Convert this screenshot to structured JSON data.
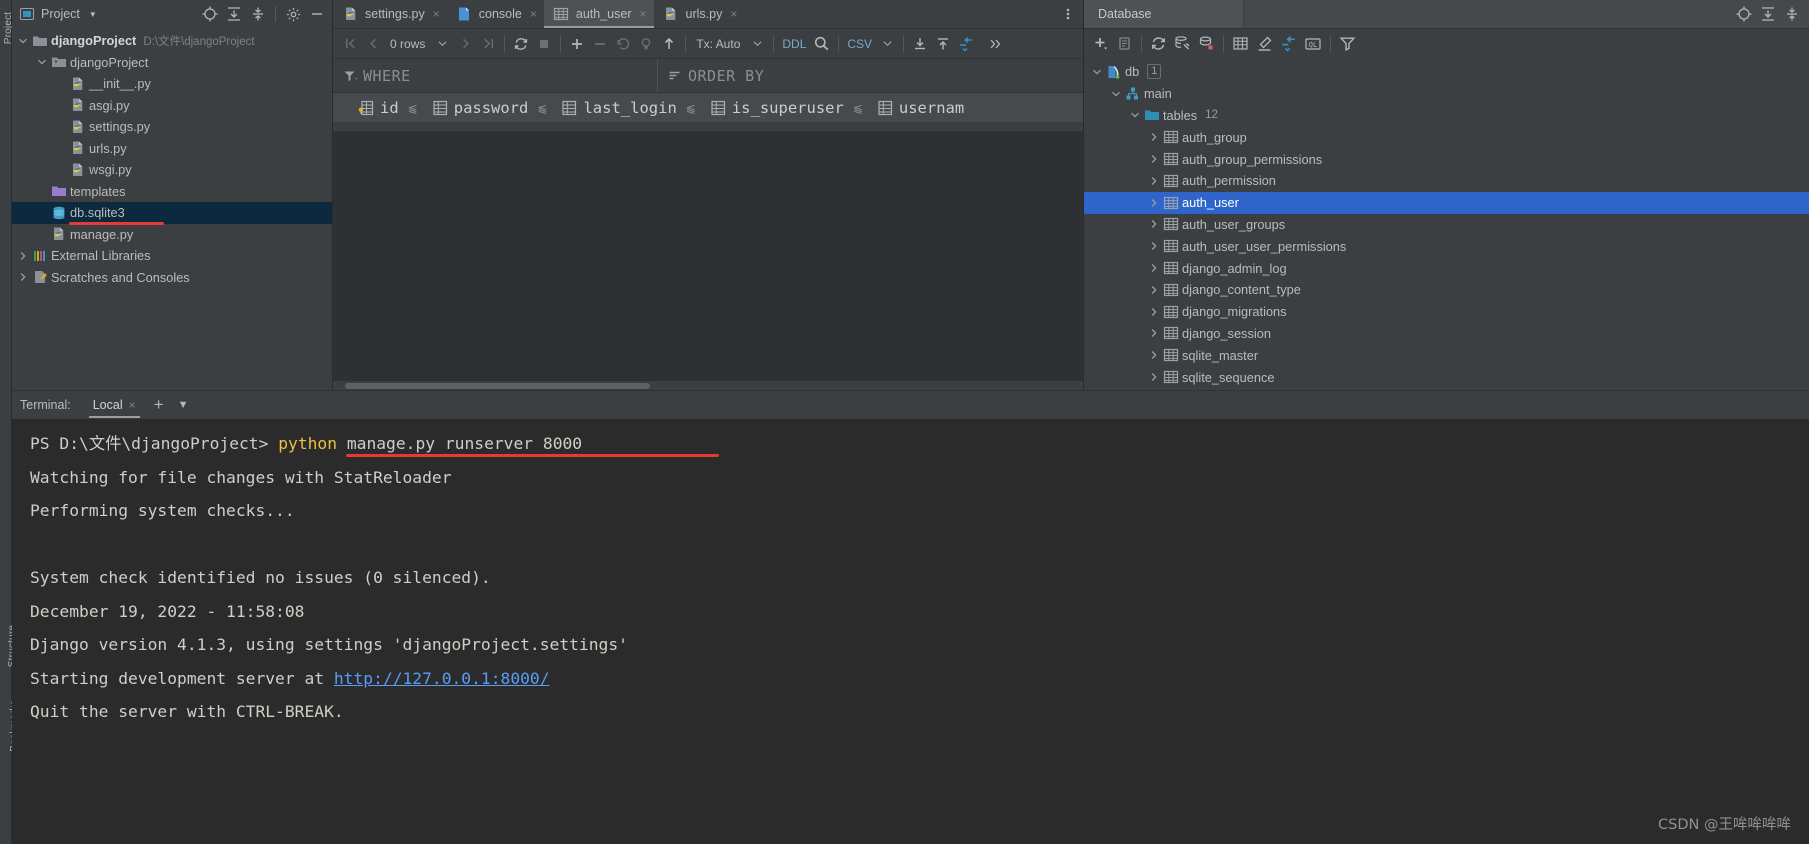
{
  "left_strip": {
    "project_tab": "Project",
    "structure_tab": "Structure",
    "bookmarks_tab": "Bookmarks"
  },
  "project_panel": {
    "title": "Project",
    "tools": [
      "locate-icon",
      "expand-all-icon",
      "collapse-all-icon",
      "settings-icon",
      "hide-icon"
    ],
    "tree": [
      {
        "label": "djangoProject",
        "path": "D:\\文件\\djangoProject",
        "icon": "folder-module-icon",
        "arrow": "expanded",
        "indent": 0,
        "bold": true
      },
      {
        "label": "djangoProject",
        "path": "",
        "icon": "folder-package-icon",
        "arrow": "expanded",
        "indent": 1,
        "bold": false
      },
      {
        "label": "__init__.py",
        "path": "",
        "icon": "python-file-icon",
        "arrow": "none",
        "indent": 2,
        "bold": false
      },
      {
        "label": "asgi.py",
        "path": "",
        "icon": "python-file-icon",
        "arrow": "none",
        "indent": 2,
        "bold": false
      },
      {
        "label": "settings.py",
        "path": "",
        "icon": "python-file-icon",
        "arrow": "none",
        "indent": 2,
        "bold": false
      },
      {
        "label": "urls.py",
        "path": "",
        "icon": "python-file-icon",
        "arrow": "none",
        "indent": 2,
        "bold": false
      },
      {
        "label": "wsgi.py",
        "path": "",
        "icon": "python-file-icon",
        "arrow": "none",
        "indent": 2,
        "bold": false
      },
      {
        "label": "templates",
        "path": "",
        "icon": "folder-templates-icon",
        "arrow": "none",
        "indent": 1,
        "bold": false
      },
      {
        "label": "db.sqlite3",
        "path": "",
        "icon": "database-file-icon",
        "arrow": "none",
        "indent": 1,
        "bold": false,
        "selected": true,
        "underlined": true
      },
      {
        "label": "manage.py",
        "path": "",
        "icon": "python-file-icon",
        "arrow": "none",
        "indent": 1,
        "bold": false
      },
      {
        "label": "External Libraries",
        "path": "",
        "icon": "libraries-icon",
        "arrow": "collapsed",
        "indent": 0,
        "bold": false
      },
      {
        "label": "Scratches and Consoles",
        "path": "",
        "icon": "scratches-icon",
        "arrow": "collapsed",
        "indent": 0,
        "bold": false
      }
    ]
  },
  "editor": {
    "tabs": [
      {
        "label": "settings.py",
        "icon": "python-file-icon",
        "active": false
      },
      {
        "label": "console",
        "icon": "console-icon",
        "active": false
      },
      {
        "label": "auth_user",
        "icon": "table-icon",
        "active": true
      },
      {
        "label": "urls.py",
        "icon": "python-file-icon",
        "active": false
      }
    ],
    "tab_close_glyph": "×",
    "overflow_icon": "more-options-icon",
    "grid_toolbar": {
      "first_page": "first-page-icon",
      "prev_page": "prev-page-icon",
      "rows_label": "0 rows",
      "next_page": "next-page-icon",
      "last_page": "last-page-icon",
      "reload": "reload-icon",
      "stop": "stop-icon",
      "add_row": "add-row-icon",
      "delete_row": "delete-row-icon",
      "revert": "revert-icon",
      "commit": "commit-icon",
      "submit": "submit-icon",
      "tx_label": "Tx: Auto",
      "ddl_label": "DDL",
      "search": "search-icon",
      "csv_label": "CSV",
      "import": "import-icon",
      "export": "export-icon",
      "compare": "compare-icon",
      "expand": "expand-toolbar-icon"
    },
    "filters": {
      "where_label": "WHERE",
      "where_icon": "filter-icon",
      "order_label": "ORDER BY",
      "order_icon": "sort-icon"
    },
    "columns": [
      {
        "name": "id",
        "icon": "primary-key-column-icon"
      },
      {
        "name": "password",
        "icon": "column-icon"
      },
      {
        "name": "last_login",
        "icon": "column-icon"
      },
      {
        "name": "is_superuser",
        "icon": "column-icon"
      },
      {
        "name": "usernam",
        "icon": "column-icon"
      }
    ],
    "sort_glyph": "⫹"
  },
  "database_panel": {
    "tab_title": "Database",
    "window_tools": [
      "locate-icon",
      "expand-all-icon",
      "collapse-all-icon"
    ],
    "toolbar": [
      "add-icon",
      "duplicate-icon",
      "refresh-icon",
      "run-configuration-icon",
      "data-source-properties-icon",
      "jump-to-console-icon",
      "modify-icon",
      "sync-icon",
      "query-console-icon",
      "filter-icon"
    ],
    "tree": [
      {
        "label": "db",
        "icon": "sqlite-datasource-icon",
        "arrow": "expanded",
        "indent": 0,
        "badge": "1"
      },
      {
        "label": "main",
        "icon": "schema-icon",
        "arrow": "expanded",
        "indent": 1
      },
      {
        "label": "tables",
        "icon": "folder-icon",
        "arrow": "expanded",
        "indent": 2,
        "count": "12"
      },
      {
        "label": "auth_group",
        "icon": "table-icon",
        "arrow": "collapsed",
        "indent": 3
      },
      {
        "label": "auth_group_permissions",
        "icon": "table-icon",
        "arrow": "collapsed",
        "indent": 3
      },
      {
        "label": "auth_permission",
        "icon": "table-icon",
        "arrow": "collapsed",
        "indent": 3
      },
      {
        "label": "auth_user",
        "icon": "table-icon",
        "arrow": "collapsed",
        "indent": 3,
        "selected": true
      },
      {
        "label": "auth_user_groups",
        "icon": "table-icon",
        "arrow": "collapsed",
        "indent": 3
      },
      {
        "label": "auth_user_user_permissions",
        "icon": "table-icon",
        "arrow": "collapsed",
        "indent": 3
      },
      {
        "label": "django_admin_log",
        "icon": "table-icon",
        "arrow": "collapsed",
        "indent": 3
      },
      {
        "label": "django_content_type",
        "icon": "table-icon",
        "arrow": "collapsed",
        "indent": 3
      },
      {
        "label": "django_migrations",
        "icon": "table-icon",
        "arrow": "collapsed",
        "indent": 3
      },
      {
        "label": "django_session",
        "icon": "table-icon",
        "arrow": "collapsed",
        "indent": 3
      },
      {
        "label": "sqlite_master",
        "icon": "table-icon",
        "arrow": "collapsed",
        "indent": 3
      },
      {
        "label": "sqlite_sequence",
        "icon": "table-icon",
        "arrow": "collapsed",
        "indent": 3
      }
    ]
  },
  "terminal": {
    "label": "Terminal:",
    "tab": "Local",
    "close_glyph": "×",
    "new_tab_glyph": "+",
    "chevron_glyph": "⌄",
    "lines": [
      {
        "prompt": "PS D:\\文件\\djangoProject> ",
        "keyword": "python",
        "rest": " manage.py runserver 8000",
        "underlined": true
      },
      {
        "plain": "Watching for file changes with StatReloader"
      },
      {
        "plain": "Performing system checks..."
      },
      {
        "plain": ""
      },
      {
        "plain": "System check identified no issues (0 silenced)."
      },
      {
        "plain": "December 19, 2022 - 11:58:08"
      },
      {
        "plain": "Django version 4.1.3, using settings 'djangoProject.settings'"
      },
      {
        "prefix": "Starting development server at ",
        "link": "http://127.0.0.1:8000/"
      },
      {
        "plain": "Quit the server with CTRL-BREAK."
      }
    ],
    "watermark": "CSDN @王哞哞哞哞"
  },
  "colors": {
    "accent_blue": "#3592c4",
    "selection_blue": "#2f65ca",
    "tree_selection": "#0d293e",
    "panel_bg": "#3c3f41",
    "terminal_bg": "#2b2b2b",
    "underline_red": "#e53b34",
    "keyword_yellow": "#f0c040",
    "link_blue": "#589df6"
  }
}
